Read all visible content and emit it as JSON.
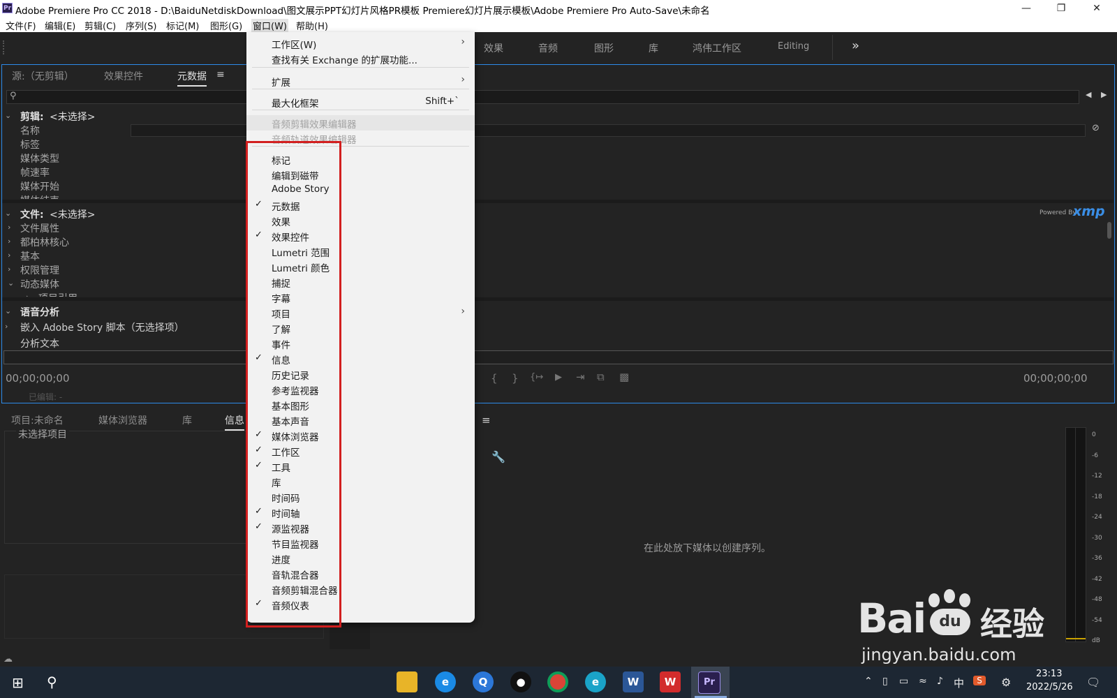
{
  "window": {
    "app_icon": "Pr",
    "title": "Adobe Premiere Pro CC 2018 - D:\\BaiduNetdiskDownload\\图文展示PPT幻灯片风格PR模板 Premiere幻灯片展示模板\\Adobe Premiere Pro Auto-Save\\未命名",
    "controls": [
      "minimize-icon",
      "restore-icon",
      "close-icon"
    ]
  },
  "menubar": [
    "文件(F)",
    "编辑(E)",
    "剪辑(C)",
    "序列(S)",
    "标记(M)",
    "图形(G)",
    "窗口(W)",
    "帮助(H)"
  ],
  "workspaces": {
    "tabs": [
      "效果",
      "音频",
      "图形",
      "库",
      "鸿伟工作区",
      "Editing"
    ],
    "overflow": "»"
  },
  "source_panel": {
    "tabs": [
      "源:（无剪辑）",
      "效果控件",
      "元数据"
    ],
    "menu_icon": "≡",
    "clip_header": "剪辑:",
    "clip_value": "<未选择>",
    "clip_fields": [
      "名称",
      "标签",
      "媒体类型",
      "帧速率",
      "媒体开始",
      "媒体结束"
    ],
    "file_header": "文件:",
    "file_value": "<未选择>",
    "file_sections": [
      "文件属性",
      "都柏林核心",
      "基本",
      "权限管理",
      "动态媒体"
    ],
    "sub_item": "项目引用",
    "speech_header": "语音分析",
    "embed_label": "嵌入 Adobe Story 脚本（无选择项）",
    "analyze_label": "分析文本",
    "timecode_left": "00;00;00;00",
    "timecode_right": "00;00;00;00",
    "edited_label": "已编辑: -",
    "powered_by": "Powered By",
    "xmp": "xmp"
  },
  "project_panel": {
    "tabs": [
      "项目:未命名",
      "媒体浏览器",
      "库",
      "信息"
    ],
    "no_selection": "未选择项目"
  },
  "program_panel": {
    "drop_hint": "在此处放下媒体以创建序列。"
  },
  "audio_meter": {
    "scale": [
      "0",
      "-6",
      "-12",
      "-18",
      "-24",
      "-30",
      "-36",
      "-42",
      "-48",
      "-54",
      "dB"
    ]
  },
  "window_menu": {
    "items": [
      {
        "label": "工作区(W)",
        "checked": false,
        "submenu": true,
        "disabled": false
      },
      {
        "label": "查找有关 Exchange 的扩展功能...",
        "checked": false,
        "submenu": false,
        "disabled": false
      },
      {
        "label": "扩展",
        "checked": false,
        "submenu": true,
        "disabled": false
      },
      {
        "label": "最大化框架",
        "checked": false,
        "submenu": false,
        "disabled": false,
        "shortcut": "Shift+`"
      },
      {
        "label": "音频剪辑效果编辑器",
        "checked": false,
        "submenu": false,
        "disabled": true
      },
      {
        "label": "音频轨道效果编辑器",
        "checked": false,
        "submenu": false,
        "disabled": true
      },
      {
        "label": "标记",
        "checked": false,
        "submenu": false,
        "disabled": false
      },
      {
        "label": "编辑到磁带",
        "checked": false,
        "submenu": false,
        "disabled": false
      },
      {
        "label": "Adobe Story",
        "checked": false,
        "submenu": false,
        "disabled": false
      },
      {
        "label": "元数据",
        "checked": true,
        "submenu": false,
        "disabled": false
      },
      {
        "label": "效果",
        "checked": false,
        "submenu": false,
        "disabled": false
      },
      {
        "label": "效果控件",
        "checked": true,
        "submenu": false,
        "disabled": false
      },
      {
        "label": "Lumetri 范围",
        "checked": false,
        "submenu": false,
        "disabled": false
      },
      {
        "label": "Lumetri 颜色",
        "checked": false,
        "submenu": false,
        "disabled": false
      },
      {
        "label": "捕捉",
        "checked": false,
        "submenu": false,
        "disabled": false
      },
      {
        "label": "字幕",
        "checked": false,
        "submenu": false,
        "disabled": false
      },
      {
        "label": "项目",
        "checked": false,
        "submenu": true,
        "disabled": false
      },
      {
        "label": "了解",
        "checked": false,
        "submenu": false,
        "disabled": false
      },
      {
        "label": "事件",
        "checked": false,
        "submenu": false,
        "disabled": false
      },
      {
        "label": "信息",
        "checked": true,
        "submenu": false,
        "disabled": false
      },
      {
        "label": "历史记录",
        "checked": false,
        "submenu": false,
        "disabled": false
      },
      {
        "label": "参考监视器",
        "checked": false,
        "submenu": false,
        "disabled": false
      },
      {
        "label": "基本图形",
        "checked": false,
        "submenu": false,
        "disabled": false
      },
      {
        "label": "基本声音",
        "checked": false,
        "submenu": false,
        "disabled": false
      },
      {
        "label": "媒体浏览器",
        "checked": true,
        "submenu": false,
        "disabled": false
      },
      {
        "label": "工作区",
        "checked": true,
        "submenu": false,
        "disabled": false
      },
      {
        "label": "工具",
        "checked": true,
        "submenu": false,
        "disabled": false
      },
      {
        "label": "库",
        "checked": false,
        "submenu": false,
        "disabled": false
      },
      {
        "label": "时间码",
        "checked": false,
        "submenu": false,
        "disabled": false
      },
      {
        "label": "时间轴",
        "checked": true,
        "submenu": false,
        "disabled": false
      },
      {
        "label": "源监视器",
        "checked": true,
        "submenu": false,
        "disabled": false
      },
      {
        "label": "节目监视器",
        "checked": false,
        "submenu": false,
        "disabled": false
      },
      {
        "label": "进度",
        "checked": false,
        "submenu": false,
        "disabled": false
      },
      {
        "label": "音轨混合器",
        "checked": false,
        "submenu": false,
        "disabled": false
      },
      {
        "label": "音频剪辑混合器",
        "checked": false,
        "submenu": false,
        "disabled": false
      },
      {
        "label": "音频仪表",
        "checked": true,
        "submenu": false,
        "disabled": false
      }
    ],
    "highlight_color": "#d21f1f"
  },
  "taskbar": {
    "apps": [
      "explorer-icon",
      "ie-icon",
      "browser-icon",
      "qq-icon",
      "chrome-icon",
      "edge-icon",
      "word-icon",
      "wps-icon",
      "premiere-icon"
    ],
    "ime": "中",
    "time": "23:13",
    "date": "2022/5/26"
  },
  "watermark": {
    "brand": "Bai",
    "paw": "du",
    "jingyan": "经验",
    "url": "jingyan.baidu.com"
  },
  "colors": {
    "panel_focus": "#2d8ceb",
    "xmp_blue": "#3a8ee6"
  }
}
